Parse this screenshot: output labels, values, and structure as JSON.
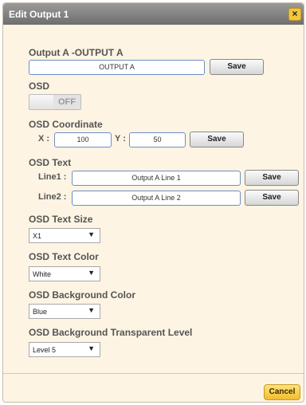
{
  "dialog": {
    "title": "Edit Output 1",
    "close_icon": "×"
  },
  "output": {
    "heading": "Output A -OUTPUT A",
    "name_value": "OUTPUT A",
    "save_label": "Save"
  },
  "osd": {
    "heading": "OSD",
    "toggle_state": "OFF"
  },
  "coordinate": {
    "heading": "OSD Coordinate",
    "x_label": "X :",
    "x_value": "100",
    "y_label": "Y :",
    "y_value": "50",
    "save_label": "Save"
  },
  "text": {
    "heading": "OSD Text",
    "line1_label": "Line1 :",
    "line1_value": "Output A Line 1",
    "line1_save": "Save",
    "line2_label": "Line2 :",
    "line2_value": "Output A Line 2",
    "line2_save": "Save"
  },
  "text_size": {
    "heading": "OSD Text Size",
    "value": "X1",
    "arrow": "▼"
  },
  "text_color": {
    "heading": "OSD Text Color",
    "value": "White",
    "arrow": "▼"
  },
  "bg_color": {
    "heading": "OSD Background Color",
    "value": "Blue",
    "arrow": "▼"
  },
  "bg_level": {
    "heading": "OSD Background Transparent Level",
    "value": "Level 5",
    "arrow": "▼"
  },
  "footer": {
    "cancel_label": "Cancel"
  },
  "colors": {
    "dialog_bg": "#fdf4e3",
    "titlebar": "#7a7a7a",
    "accent_button": "#f3bd2e",
    "input_border": "#6b8fc7"
  }
}
